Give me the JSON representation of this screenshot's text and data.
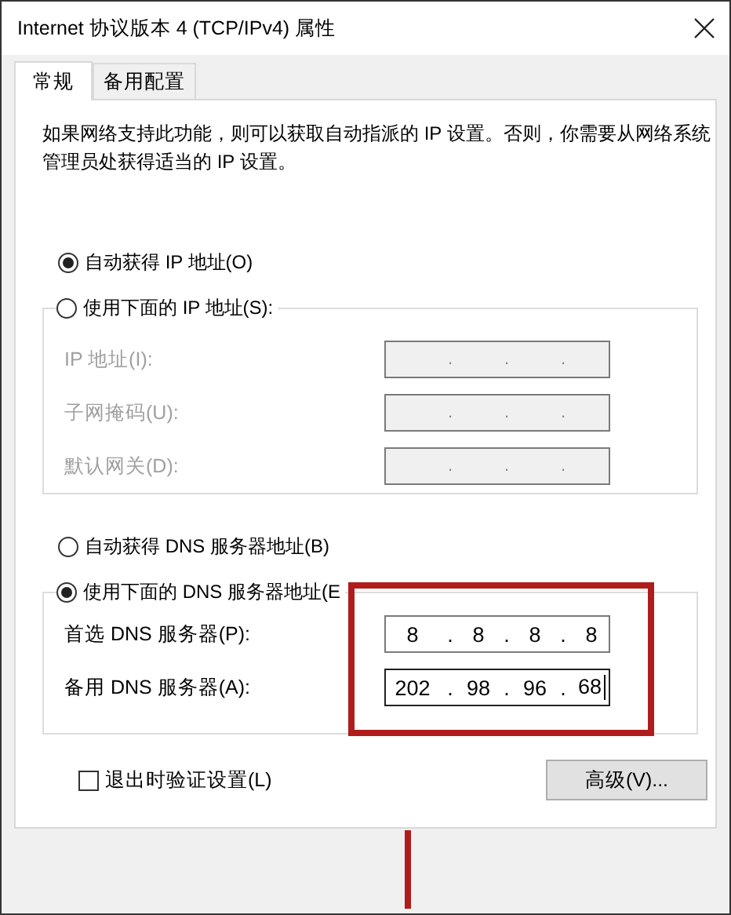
{
  "window": {
    "title": "Internet 协议版本 4 (TCP/IPv4) 属性"
  },
  "tabs": [
    {
      "label": "常规",
      "selected": true
    },
    {
      "label": "备用配置",
      "selected": false
    }
  ],
  "description": "如果网络支持此功能，则可以获取自动指派的 IP 设置。否则，你需要从网络系统管理员处获得适当的 IP 设置。",
  "ip_mode": [
    {
      "label": "自动获得 IP 地址(O)",
      "selected": true
    },
    {
      "label": "使用下面的 IP 地址(S):",
      "selected": false
    }
  ],
  "ip_fields": [
    {
      "label": "IP 地址(I):",
      "disabled": true,
      "focused": false,
      "parts": [
        ".",
        ".",
        "."
      ]
    },
    {
      "label": "子网掩码(U):",
      "disabled": true,
      "focused": false,
      "parts": [
        ".",
        ".",
        "."
      ]
    },
    {
      "label": "默认网关(D):",
      "disabled": true,
      "focused": false,
      "parts": [
        ".",
        ".",
        "."
      ]
    }
  ],
  "dns_mode": [
    {
      "label": "自动获得 DNS 服务器地址(B)",
      "selected": false
    },
    {
      "label": "使用下面的 DNS 服务器地址(E",
      "selected": true
    }
  ],
  "dns_fields": [
    {
      "label": "首选 DNS 服务器(P):",
      "disabled": false,
      "focused": false,
      "parts": [
        "8",
        ".",
        "8",
        ".",
        "8",
        ".",
        "8"
      ]
    },
    {
      "label": "备用 DNS 服务器(A):",
      "disabled": false,
      "focused": true,
      "parts": [
        "202",
        ".",
        "98",
        ".",
        "96",
        ".",
        "68"
      ]
    }
  ],
  "validate_on_exit": {
    "label": "退出时验证设置(L)",
    "checked": false
  },
  "advanced_button": "高级(V)..."
}
